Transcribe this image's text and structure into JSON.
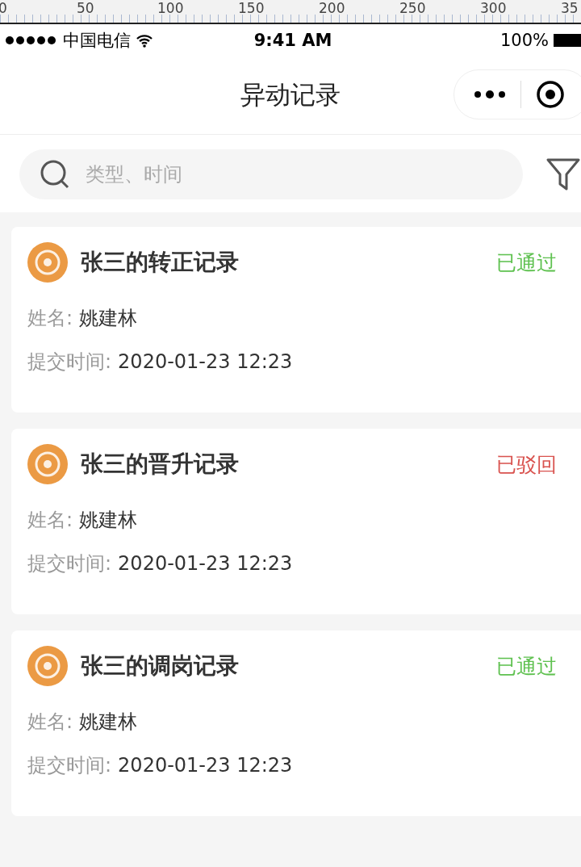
{
  "ruler": {
    "labels": [
      "0",
      "50",
      "100",
      "150",
      "200",
      "250",
      "300",
      "35"
    ]
  },
  "status_bar": {
    "carrier": "中国电信",
    "time": "9:41 AM",
    "battery": "100%"
  },
  "nav": {
    "title": "异动记录"
  },
  "search": {
    "placeholder": "类型、时间"
  },
  "records": [
    {
      "title": "张三的转正记录",
      "status": "已通过",
      "color": "#5fc150",
      "name_label": "姓名:",
      "name": "姚建林",
      "time_label": "提交时间:",
      "time": "2020-01-23 12:23"
    },
    {
      "title": "张三的晋升记录",
      "status": "已驳回",
      "color": "#d9534f",
      "name_label": "姓名:",
      "name": "姚建林",
      "time_label": "提交时间:",
      "time": "2020-01-23 12:23"
    },
    {
      "title": "张三的调岗记录",
      "status": "已通过",
      "color": "#5fc150",
      "name_label": "姓名:",
      "name": "姚建林",
      "time_label": "提交时间:",
      "time": "2020-01-23 12:23"
    }
  ]
}
